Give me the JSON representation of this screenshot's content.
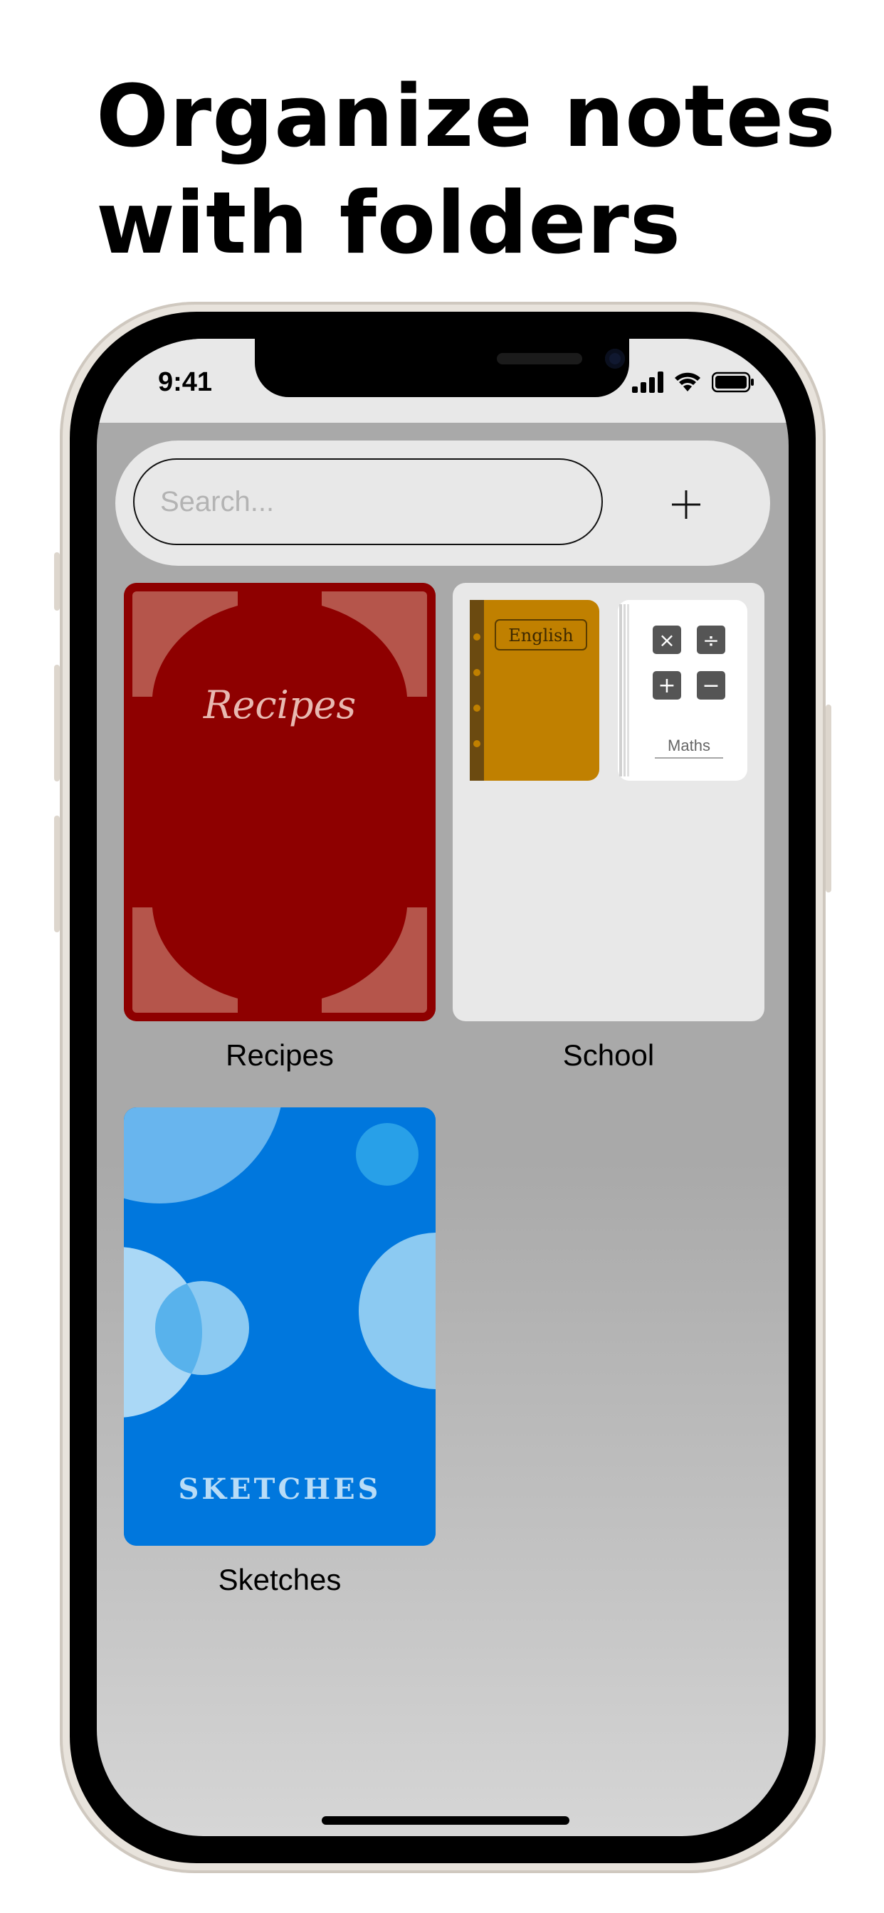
{
  "headline": {
    "line1": "Organize notes",
    "line2": "with folders"
  },
  "status_bar": {
    "time": "9:41",
    "icons": [
      "signal-icon",
      "wifi-icon",
      "battery-icon"
    ]
  },
  "search": {
    "placeholder": "Search...",
    "add_icon": "plus-icon"
  },
  "folders": [
    {
      "name": "Recipes",
      "cover_title": "Recipes",
      "color": "#8e0000"
    },
    {
      "name": "School",
      "notebooks": [
        {
          "title": "English",
          "color": "#c08000"
        },
        {
          "title": "Maths",
          "color": "#ffffff",
          "symbols": [
            "×",
            "÷",
            "+",
            "−"
          ]
        }
      ],
      "color": "#e8e8e8"
    },
    {
      "name": "Sketches",
      "cover_title": "Sketches",
      "color": "#0077dd"
    }
  ]
}
